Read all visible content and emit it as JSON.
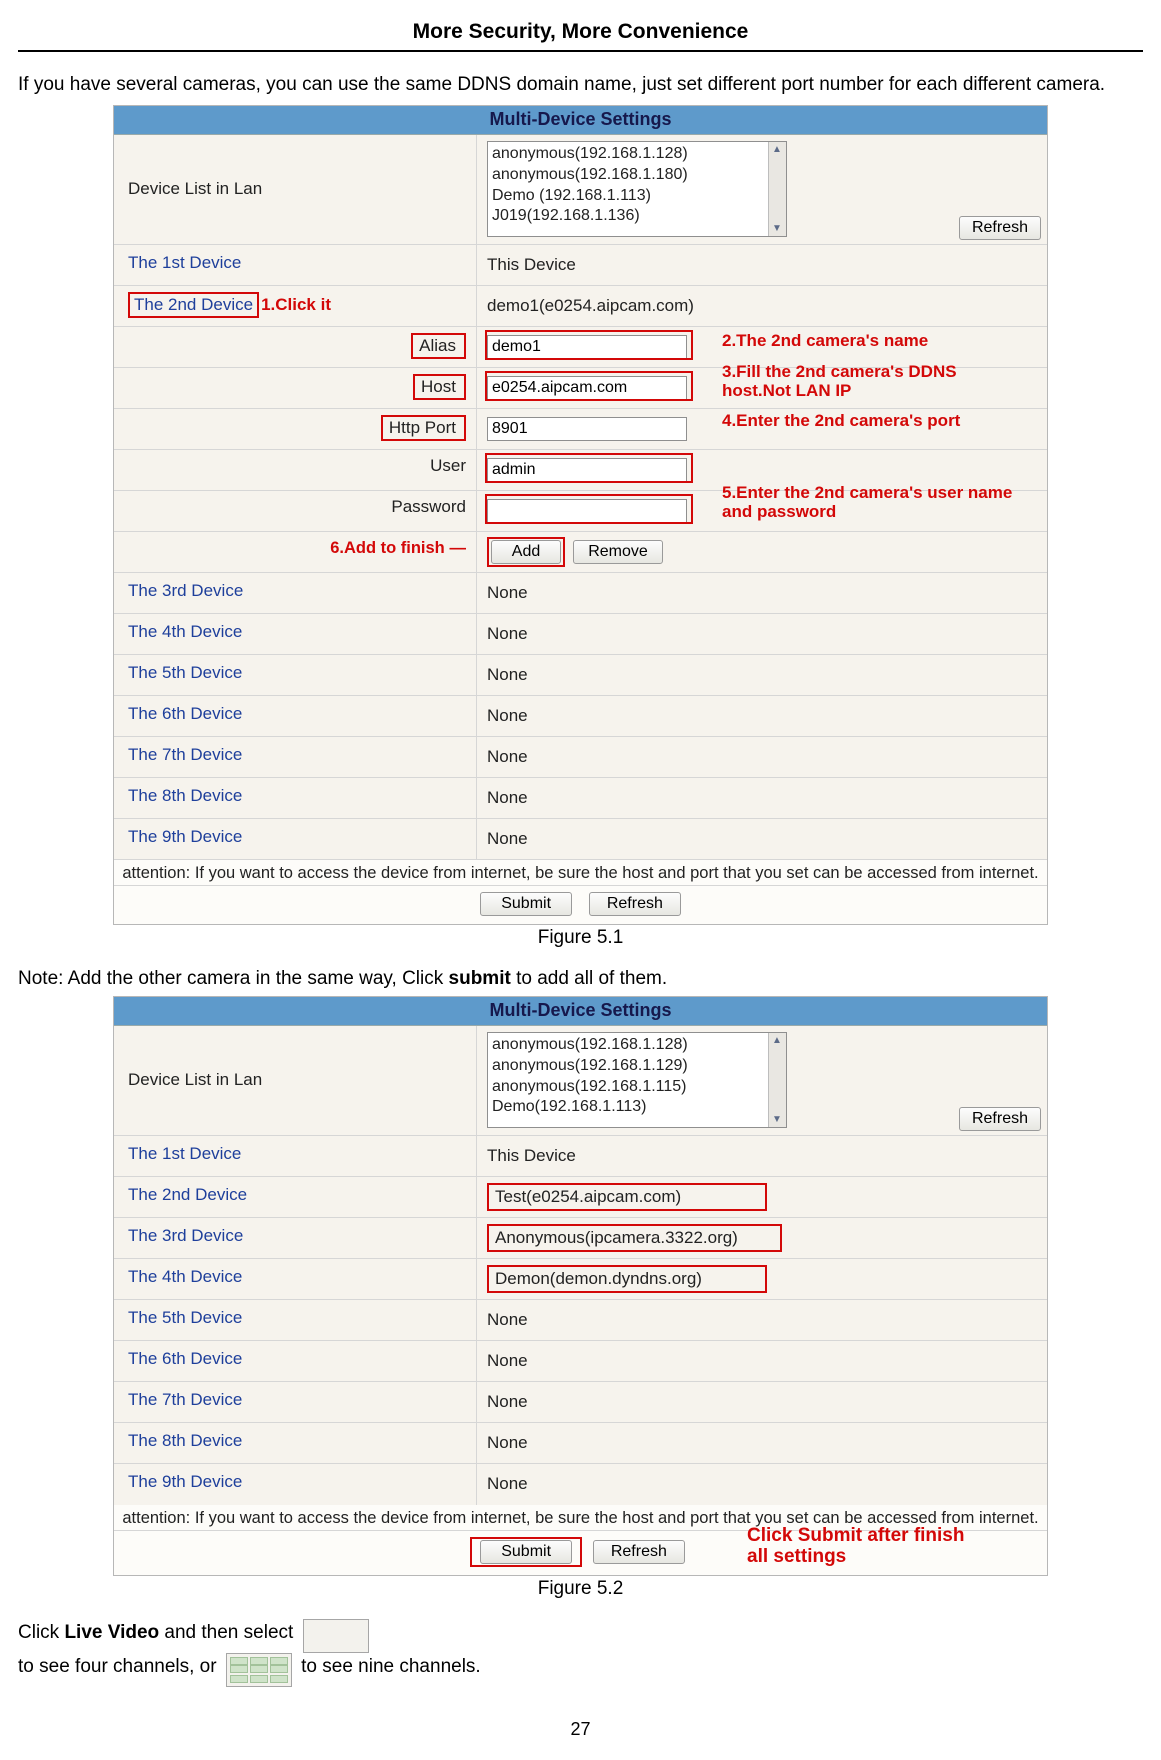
{
  "header": "More Security, More Convenience",
  "intro": "If you have several cameras, you can use the same DDNS domain name, just set different port number for each different camera.",
  "fig1": {
    "title": "Multi-Device Settings",
    "devlist_label": "Device List in Lan",
    "devlist_items": [
      "anonymous(192.168.1.128)",
      "anonymous(192.168.1.180)",
      "Demo (192.168.1.113)",
      "J019(192.168.1.136)"
    ],
    "refresh": "Refresh",
    "row1_l": "The 1st Device",
    "row1_r": "This Device",
    "row2_l": "The 2nd Device",
    "row2_r": "demo1(e0254.aipcam.com)",
    "alias_l": "Alias",
    "alias_v": "demo1",
    "host_l": "Host",
    "host_v": "e0254.aipcam.com",
    "port_l": "Http Port",
    "port_v": "8901",
    "user_l": "User",
    "user_v": "admin",
    "pw_l": "Password",
    "pw_v": "",
    "add": "Add",
    "remove": "Remove",
    "row3_l": "The 3rd Device",
    "row4_l": "The 4th Device",
    "row5_l": "The 5th Device",
    "row6_l": "The 6th Device",
    "row7_l": "The 7th Device",
    "row8_l": "The 8th Device",
    "row9_l": "The 9th Device",
    "none": "None",
    "attn": "attention: If you want to access the device from internet, be sure the host and port that you set can be accessed from internet.",
    "submit": "Submit",
    "caption": "Figure 5.1",
    "anno_click": "1.Click it",
    "anno2": "2.The 2nd camera's name",
    "anno3": "3.Fill the 2nd camera's DDNS host.Not LAN IP",
    "anno4": "4.Enter the 2nd camera's port",
    "anno5": "5.Enter the 2nd camera's user name and password",
    "anno6": "6.Add to finish"
  },
  "note_prefix": "Note: Add the other camera in the same way, Click ",
  "note_bold": "submit",
  "note_suffix": " to add all of them.",
  "fig2": {
    "title": "Multi-Device Settings",
    "devlist_label": "Device List in Lan",
    "devlist_items": [
      "anonymous(192.168.1.128)",
      "anonymous(192.168.1.129)",
      "anonymous(192.168.1.115)",
      "Demo(192.168.1.113)"
    ],
    "refresh": "Refresh",
    "rows": [
      {
        "l": "The 1st Device",
        "r": "This Device",
        "box": false
      },
      {
        "l": "The 2nd Device",
        "r": "Test(e0254.aipcam.com)",
        "box": true
      },
      {
        "l": "The 3rd Device",
        "r": "Anonymous(ipcamera.3322.org)",
        "box": true
      },
      {
        "l": "The 4th Device",
        "r": "Demon(demon.dyndns.org)",
        "box": true
      },
      {
        "l": "The 5th Device",
        "r": "None",
        "box": false
      },
      {
        "l": "The 6th Device",
        "r": "None",
        "box": false
      },
      {
        "l": "The 7th Device",
        "r": "None",
        "box": false
      },
      {
        "l": "The 8th Device",
        "r": "None",
        "box": false
      },
      {
        "l": "The 9th Device",
        "r": "None",
        "box": false
      }
    ],
    "attn": "attention: If you want to access the device from internet, be sure the host and port that you set can be accessed from internet.",
    "submit": "Submit",
    "caption": "Figure 5.2",
    "anno_submit": "Click Submit after finish all settings"
  },
  "final_prefix": "Click ",
  "final_bold": "Live Video",
  "final_mid1": " and then select ",
  "final_mid2": " to see four channels, or ",
  "final_suffix": " to see nine channels.",
  "page_num": "27"
}
